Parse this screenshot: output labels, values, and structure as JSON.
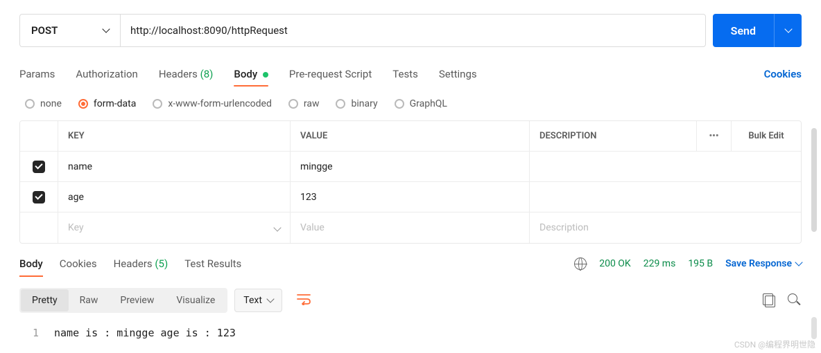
{
  "request": {
    "method": "POST",
    "url": "http://localhost:8090/httpRequest",
    "send_label": "Send"
  },
  "tabs": {
    "params": "Params",
    "authorization": "Authorization",
    "headers": "Headers",
    "headers_count": "(8)",
    "body": "Body",
    "prerequest": "Pre-request Script",
    "tests": "Tests",
    "settings": "Settings",
    "cookies_link": "Cookies"
  },
  "body_types": {
    "none": "none",
    "form_data": "form-data",
    "urlencoded": "x-www-form-urlencoded",
    "raw": "raw",
    "binary": "binary",
    "graphql": "GraphQL"
  },
  "grid": {
    "headers": {
      "key": "KEY",
      "value": "VALUE",
      "description": "DESCRIPTION",
      "dots": "•••",
      "bulk": "Bulk Edit"
    },
    "rows": [
      {
        "checked": true,
        "key": "name",
        "value": "mingge",
        "description": ""
      },
      {
        "checked": true,
        "key": "age",
        "value": "123",
        "description": ""
      }
    ],
    "placeholders": {
      "key": "Key",
      "value": "Value",
      "description": "Description"
    }
  },
  "response_tabs": {
    "body": "Body",
    "cookies": "Cookies",
    "headers": "Headers",
    "headers_count": "(5)",
    "test_results": "Test Results"
  },
  "response_meta": {
    "status": "200 OK",
    "time": "229 ms",
    "size": "195 B",
    "save_response": "Save Response"
  },
  "view_modes": {
    "pretty": "Pretty",
    "raw": "Raw",
    "preview": "Preview",
    "visualize": "Visualize",
    "lang": "Text"
  },
  "response_body": {
    "line1_no": "1",
    "line1_text": "name is : mingge age is : 123"
  },
  "watermark": "CSDN @编程界明世隐"
}
